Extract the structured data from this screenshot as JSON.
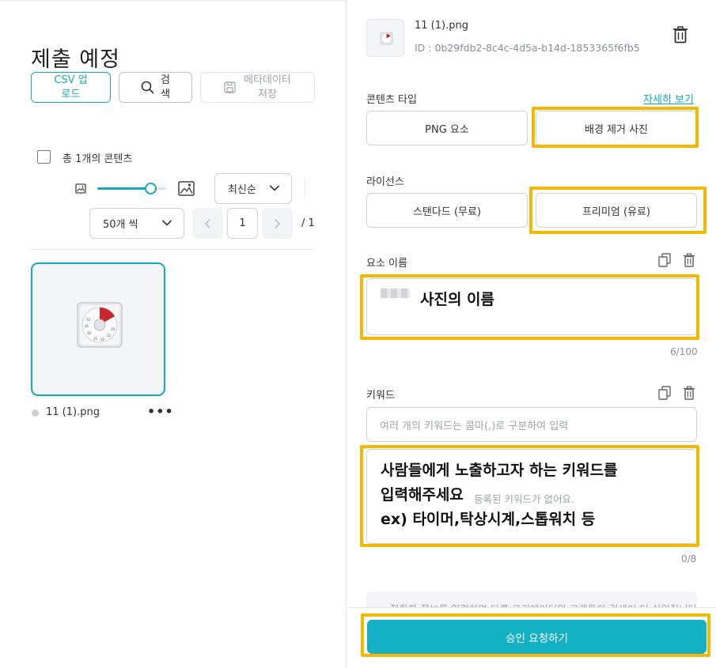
{
  "left": {
    "page_title": "제출 예정",
    "toolbar": {
      "csv_upload": "CSV 업\n로드",
      "search": "검\n색",
      "save_metadata": "메타데이터\n저장"
    },
    "content_count": "총 1개의 콘텐츠",
    "sort": {
      "selected": "최신순"
    },
    "per_page": {
      "selected": "50개 씩"
    },
    "pagination": {
      "current": "1",
      "total": "/ 1"
    },
    "items": [
      {
        "name": "11 (1).png",
        "more": "•••"
      }
    ]
  },
  "right": {
    "file": {
      "name": "11 (1).png",
      "id": "ID : 0b29fdb2-8c4c-4d5a-b14d-1853365f6fb5"
    },
    "content_type": {
      "label": "콘텐츠 타입",
      "detail_link": "자세히 보기",
      "options": [
        "PNG 요소",
        "배경 제거 사진"
      ]
    },
    "license": {
      "label": "라이선스",
      "options": [
        "스탠다드 (무료)",
        "프리미엄 (유료)"
      ]
    },
    "element_name": {
      "label": "요소 이름",
      "overlay_text": "사진의 이름",
      "count": "6/100"
    },
    "keywords": {
      "label": "키워드",
      "placeholder": "여러 개의 키워드는 콤마(,)로 구분하여 입력",
      "empty_text": "등록된 키워드가 없어요.",
      "overlay_lines": [
        "사람들에게 노출하고자 하는 키워드를",
        "입력해주세요",
        "ex) 타이머,탁상시계,스톱워치 등"
      ],
      "count": "0/8"
    },
    "notice": "정확한 정보를 입력하면 다른 크리에이터와 고객들의 검색이 더 쉬워집니다.",
    "submit": "승인 요청하기"
  },
  "colors": {
    "accent": "#13a9bf",
    "highlight": "#f5b800",
    "submit": "#13b1c3"
  },
  "icons": [
    "search-icon",
    "save-icon",
    "image-small-icon",
    "image-large-icon",
    "chevron-down-icon",
    "chevron-left-icon",
    "chevron-right-icon",
    "trash-icon",
    "copy-icon"
  ]
}
